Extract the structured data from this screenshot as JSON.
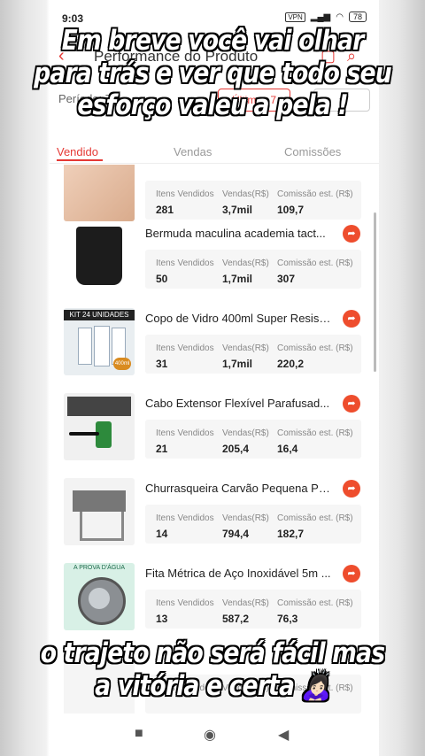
{
  "status_bar": {
    "time": "9:03",
    "vpn": "VPN",
    "battery": "78"
  },
  "header": {
    "title": "Performance do Produto"
  },
  "filter": {
    "label": "Período: 7",
    "button": "Últimos 7",
    "dropdown": "▾"
  },
  "tabs": [
    {
      "label": "Vendido",
      "active": true
    },
    {
      "label": "Vendas"
    },
    {
      "label": "Comissões"
    }
  ],
  "columns": {
    "items": "Itens Vendidos",
    "sales": "Vendas(R$)",
    "commission": "Comissão est. (R$)"
  },
  "products": [
    {
      "name": "",
      "items": "281",
      "sales": "3,7mil",
      "commission": "109,7",
      "thumb": "skin"
    },
    {
      "name": "Bermuda maculina academia  tact...",
      "items": "50",
      "sales": "1,7mil",
      "commission": "307",
      "thumb": "shorts"
    },
    {
      "name": "Copo de Vidro 400ml Super Resist...",
      "items": "31",
      "sales": "1,7mil",
      "commission": "220,2",
      "thumb": "glasses",
      "thumb_text": "KIT 24 UNIDADES",
      "thumb_badge": "400ml"
    },
    {
      "name": "Cabo Extensor Flexível Parafusad...",
      "items": "21",
      "sales": "205,4",
      "commission": "16,4",
      "thumb": "cable"
    },
    {
      "name": "Churrasqueira Carvão Pequena Po...",
      "items": "14",
      "sales": "794,4",
      "commission": "182,7",
      "thumb": "grill"
    },
    {
      "name": "Fita Métrica de Aço Inoxidável 5m ...",
      "items": "13",
      "sales": "587,2",
      "commission": "76,3",
      "thumb": "tape",
      "thumb_text": "A PROVA D'ÁGUA"
    },
    {
      "name": "",
      "items": "",
      "sales": "",
      "commission": "",
      "thumb": "blank"
    }
  ],
  "captions": {
    "top": "Em breve você vai olhar para trás e ver que todo seu esforço valeu a pela !",
    "bottom": "o trajeto não será fácil mas a vitória e certa 🙇🏻‍♀️"
  },
  "colors": {
    "accent": "#e53935",
    "share": "#ee4d2d"
  },
  "icons": {
    "back": "chevron-left-icon",
    "share": "share-arrow-icon",
    "nav": [
      "square-icon",
      "circle-icon",
      "triangle-back-icon"
    ]
  }
}
